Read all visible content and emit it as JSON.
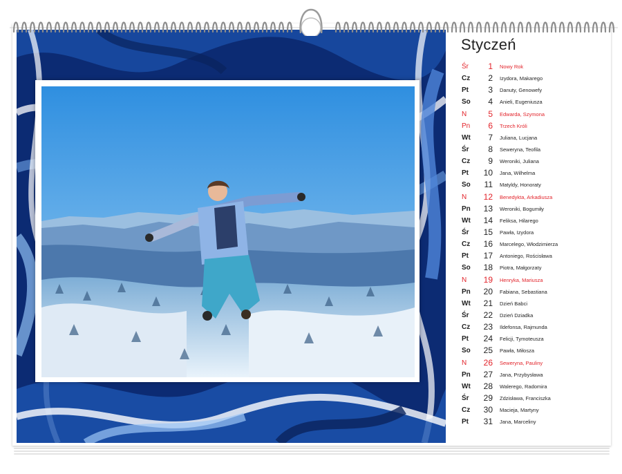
{
  "calendar": {
    "month": "Styczeń",
    "accent_holiday": "#e2232a",
    "days": [
      {
        "abbr": "Śr",
        "day": "1",
        "names": "Nowy Rok",
        "holiday": true
      },
      {
        "abbr": "Cz",
        "day": "2",
        "names": "Izydora, Makarego",
        "holiday": false
      },
      {
        "abbr": "Pt",
        "day": "3",
        "names": "Danuty, Genowefy",
        "holiday": false
      },
      {
        "abbr": "So",
        "day": "4",
        "names": "Anieli, Eugeniusza",
        "holiday": false
      },
      {
        "abbr": "N",
        "day": "5",
        "names": "Edwarda, Szymona",
        "holiday": true
      },
      {
        "abbr": "Pn",
        "day": "6",
        "names": "Trzech Króli",
        "holiday": true
      },
      {
        "abbr": "Wt",
        "day": "7",
        "names": "Juliana, Lucjana",
        "holiday": false
      },
      {
        "abbr": "Śr",
        "day": "8",
        "names": "Seweryna, Teofila",
        "holiday": false
      },
      {
        "abbr": "Cz",
        "day": "9",
        "names": "Weroniki, Juliana",
        "holiday": false
      },
      {
        "abbr": "Pt",
        "day": "10",
        "names": "Jana, Wilhelma",
        "holiday": false
      },
      {
        "abbr": "So",
        "day": "11",
        "names": "Matyldy, Honoraty",
        "holiday": false
      },
      {
        "abbr": "N",
        "day": "12",
        "names": "Benedykta, Arkadiusza",
        "holiday": true
      },
      {
        "abbr": "Pn",
        "day": "13",
        "names": "Weroniki, Bogumiły",
        "holiday": false
      },
      {
        "abbr": "Wt",
        "day": "14",
        "names": "Feliksa, Hilarego",
        "holiday": false
      },
      {
        "abbr": "Śr",
        "day": "15",
        "names": "Pawła, Izydora",
        "holiday": false
      },
      {
        "abbr": "Cz",
        "day": "16",
        "names": "Marcelego, Włodzimierza",
        "holiday": false
      },
      {
        "abbr": "Pt",
        "day": "17",
        "names": "Antoniego, Rościsława",
        "holiday": false
      },
      {
        "abbr": "So",
        "day": "18",
        "names": "Piotra, Małgorzaty",
        "holiday": false
      },
      {
        "abbr": "N",
        "day": "19",
        "names": "Henryka, Mariusza",
        "holiday": true
      },
      {
        "abbr": "Pn",
        "day": "20",
        "names": "Fabiana, Sebastiana",
        "holiday": false
      },
      {
        "abbr": "Wt",
        "day": "21",
        "names": "Dzień Babci",
        "holiday": false
      },
      {
        "abbr": "Śr",
        "day": "22",
        "names": "Dzień Dziadka",
        "holiday": false
      },
      {
        "abbr": "Cz",
        "day": "23",
        "names": "Ildefonsa, Rajmunda",
        "holiday": false
      },
      {
        "abbr": "Pt",
        "day": "24",
        "names": "Felicji, Tymoteusza",
        "holiday": false
      },
      {
        "abbr": "So",
        "day": "25",
        "names": "Pawła, Miłosza",
        "holiday": false
      },
      {
        "abbr": "N",
        "day": "26",
        "names": "Seweryna, Pauliny",
        "holiday": true
      },
      {
        "abbr": "Pn",
        "day": "27",
        "names": "Jana, Przybysława",
        "holiday": false
      },
      {
        "abbr": "Wt",
        "day": "28",
        "names": "Walerego, Radomira",
        "holiday": false
      },
      {
        "abbr": "Śr",
        "day": "29",
        "names": "Zdzisława, Franciszka",
        "holiday": false
      },
      {
        "abbr": "Cz",
        "day": "30",
        "names": "Macieja, Martyny",
        "holiday": false
      },
      {
        "abbr": "Pt",
        "day": "31",
        "names": "Jana, Marceliny",
        "holiday": false
      }
    ]
  }
}
